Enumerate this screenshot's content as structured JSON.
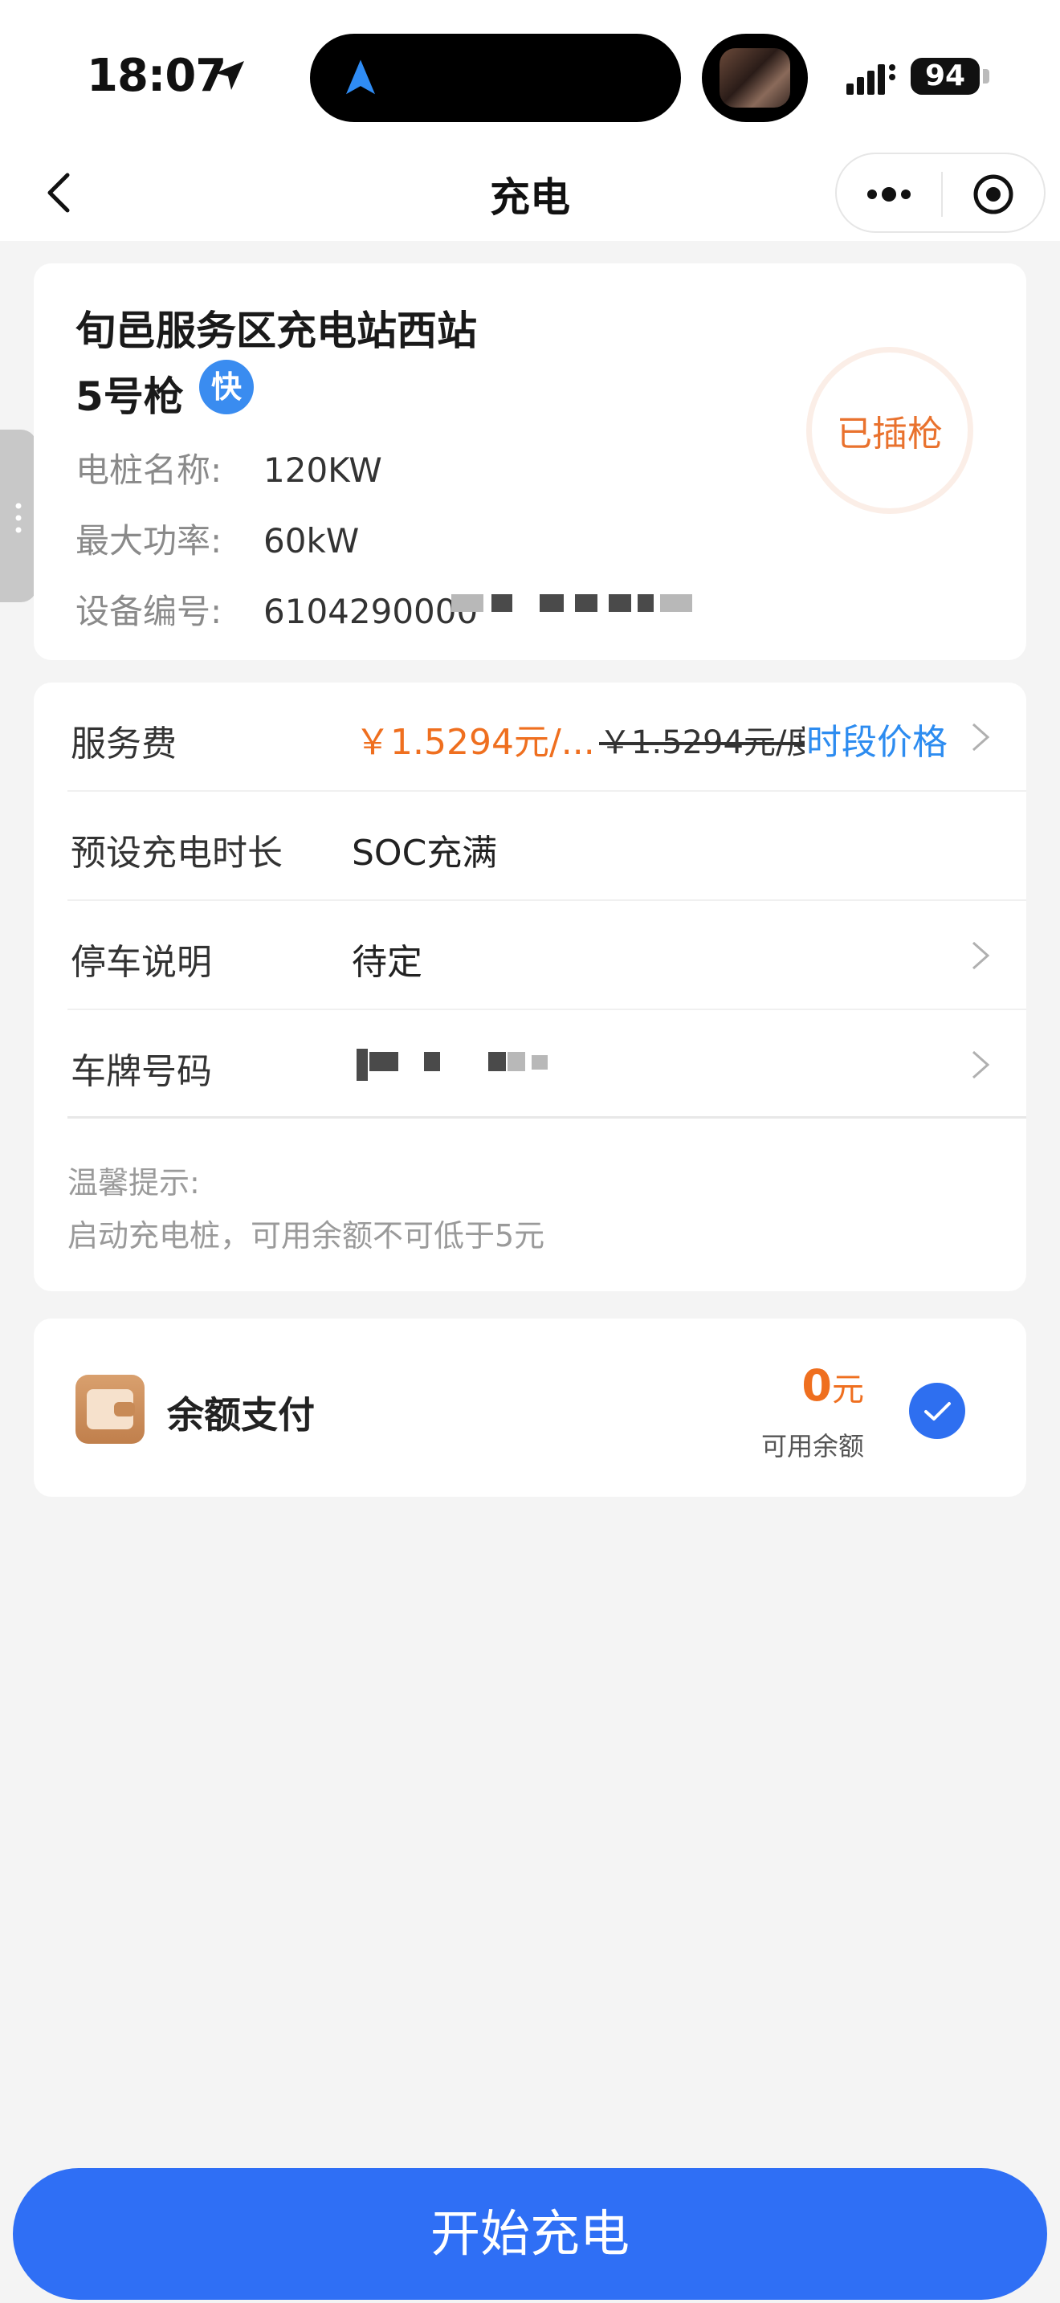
{
  "status_bar": {
    "time": "18:07",
    "battery": "94"
  },
  "nav": {
    "title": "充电"
  },
  "station": {
    "name": "旬邑服务区充电站西站",
    "gun": "5号枪",
    "fast_badge": "快",
    "status": "已插枪",
    "rows": [
      {
        "label": "电桩名称:",
        "value": "120KW"
      },
      {
        "label": "最大功率:",
        "value": "60kW"
      },
      {
        "label": "设备编号:",
        "value": "6104290000"
      }
    ]
  },
  "form": {
    "service_fee": {
      "label": "服务费",
      "current_price": "￥1.5294元/...",
      "original_price": "￥1.5294元/度",
      "period_link": "时段价格"
    },
    "duration": {
      "label": "预设充电时长",
      "value": "SOC充满"
    },
    "parking": {
      "label": "停车说明",
      "value": "待定"
    },
    "plate": {
      "label": "车牌号码",
      "value": ""
    },
    "tips_title": "温馨提示:",
    "tips_text": "启动充电桩，可用余额不可低于5元"
  },
  "payment": {
    "method": "余额支付",
    "amount": "0",
    "unit": "元",
    "balance_label": "可用余额",
    "selected": true
  },
  "actions": {
    "start": "开始充电"
  },
  "colors": {
    "primary": "#2f6ff5",
    "accent_orange": "#ef6f1f",
    "link_blue": "#2d8cf0",
    "background": "#f4f4f4"
  },
  "icons": [
    "back-arrow-icon",
    "more-dots-icon",
    "target-icon",
    "chevron-right-icon",
    "wallet-icon",
    "checkmark-icon",
    "location-arrow-icon",
    "navigation-icon"
  ]
}
